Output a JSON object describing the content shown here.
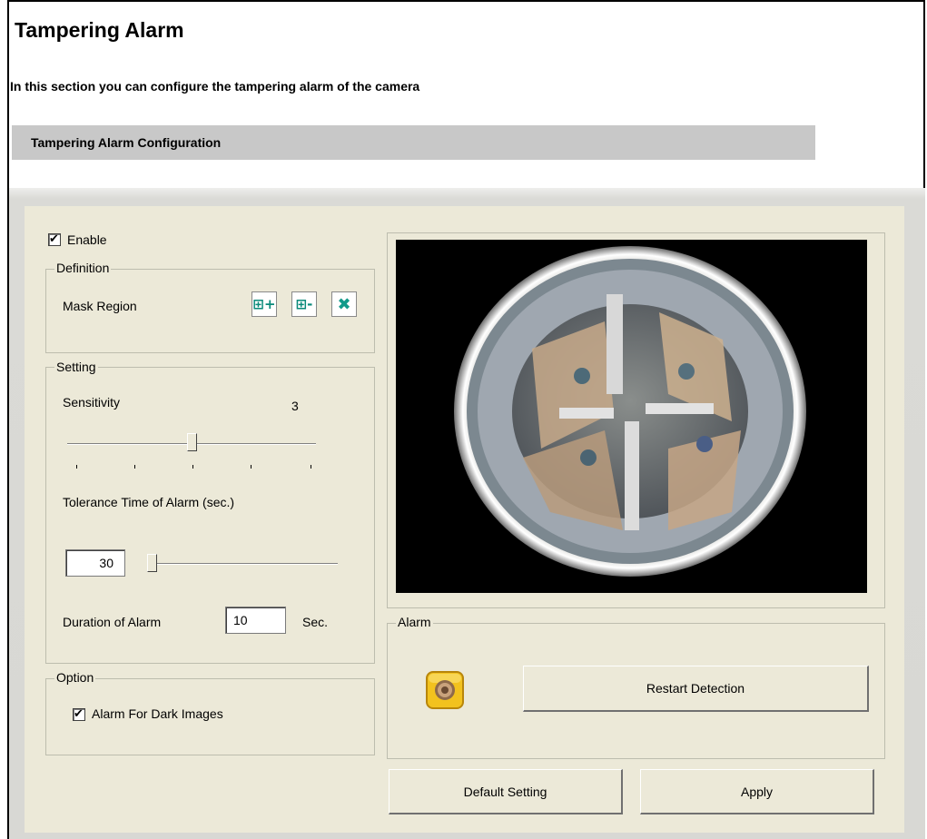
{
  "page": {
    "title": "Tampering Alarm",
    "subtitle": "In this section you can configure the tampering alarm of the camera",
    "section_header": "Tampering Alarm Configuration"
  },
  "enable": {
    "label": "Enable",
    "checked": true
  },
  "definition": {
    "legend": "Definition",
    "mask_region_label": "Mask Region",
    "tools": [
      {
        "name": "add-mask-region",
        "icon": "grid-plus-icon"
      },
      {
        "name": "remove-mask-region",
        "icon": "grid-minus-icon"
      },
      {
        "name": "clear-mask-region",
        "icon": "clear-x-icon"
      }
    ]
  },
  "setting": {
    "legend": "Setting",
    "sensitivity_label": "Sensitivity",
    "sensitivity_value": "3",
    "sensitivity_range": [
      1,
      5
    ],
    "tolerance_label": "Tolerance Time of Alarm (sec.)",
    "tolerance_value": "30",
    "duration_label": "Duration of Alarm",
    "duration_value": "10",
    "duration_unit": "Sec."
  },
  "option": {
    "legend": "Option",
    "dark_images_label": "Alarm For Dark Images",
    "dark_images_checked": true
  },
  "alarm": {
    "legend": "Alarm",
    "indicator_icon": "alarm-light-icon",
    "restart_label": "Restart Detection"
  },
  "buttons": {
    "default_label": "Default Setting",
    "apply_label": "Apply"
  }
}
